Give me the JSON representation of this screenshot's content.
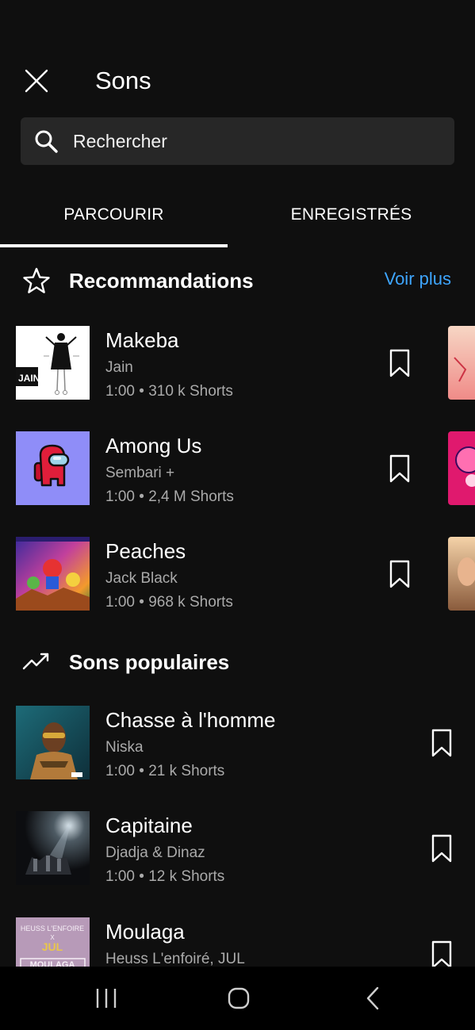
{
  "header": {
    "title": "Sons",
    "close_icon": "close-icon"
  },
  "search": {
    "placeholder": "Rechercher",
    "icon": "search-icon"
  },
  "tabs": [
    {
      "label": "PARCOURIR",
      "selected": true
    },
    {
      "label": "ENREGISTRÉS",
      "selected": false
    }
  ],
  "recommendations": {
    "title": "Recommandations",
    "icon": "star-icon",
    "more_label": "Voir plus",
    "more_color": "#3ea6ff",
    "items": [
      {
        "title": "Makeba",
        "artist": "Jain",
        "duration": "1:00",
        "shorts": "310 k Shorts"
      },
      {
        "title": "Among Us",
        "artist": "Sembari +",
        "duration": "1:00",
        "shorts": "2,4 M Shorts"
      },
      {
        "title": "Peaches",
        "artist": "Jack Black",
        "duration": "1:00",
        "shorts": "968 k Shorts"
      }
    ]
  },
  "popular": {
    "title": "Sons populaires",
    "icon": "trending-icon",
    "items": [
      {
        "title": "Chasse à l'homme",
        "artist": "Niska",
        "duration": "1:00",
        "shorts": "21 k Shorts"
      },
      {
        "title": "Capitaine",
        "artist": "Djadja & Dinaz",
        "duration": "1:00",
        "shorts": "12 k Shorts"
      },
      {
        "title": "Moulaga",
        "artist": "Heuss L'enfoiré, JUL",
        "duration": "",
        "shorts": ""
      }
    ]
  },
  "album_art_text": {
    "makeba": "JAIN",
    "moulaga_top": "HEUSS L'ENFOIRE",
    "moulaga_x": "X",
    "moulaga_jul": "JUL",
    "moulaga_bottom": "MOULAGA"
  },
  "separator": "•",
  "navbar": {
    "recent_icon": "recent-apps-icon",
    "home_icon": "home-icon",
    "back_icon": "back-icon"
  },
  "colors": {
    "background": "#0f0f0f",
    "search_bg": "#272727",
    "secondary_text": "#aaaaaa",
    "link": "#3ea6ff"
  }
}
